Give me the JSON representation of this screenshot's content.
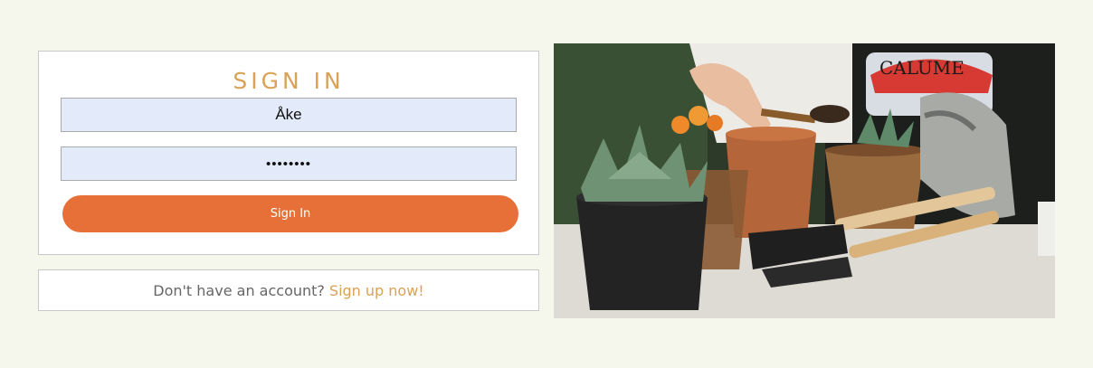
{
  "login": {
    "title": "SIGN IN",
    "username_value": "Åke",
    "password_value": "••••••••",
    "submit_label": "Sign In"
  },
  "signup": {
    "prompt": "Don't have an account?",
    "link_label": "Sign up now!"
  },
  "colors": {
    "background": "#f5f7ec",
    "accent_title": "#d9a256",
    "button": "#e67038",
    "input_bg": "#e3ebfb"
  },
  "photo": {
    "alt_subject": "gardening-hands-potting-succulents",
    "shirt_print": "CALUME"
  }
}
